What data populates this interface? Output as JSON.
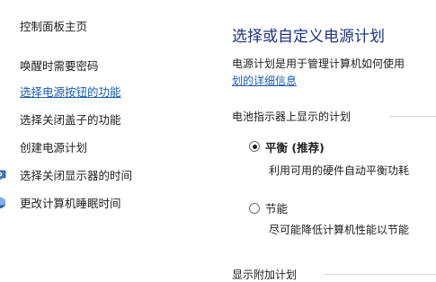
{
  "sidebar": {
    "home": "控制面板主页",
    "items": [
      "唤醒时需要密码",
      "选择电源按钮的功能",
      "选择关闭盖子的功能",
      "创建电源计划",
      "选择关闭显示器的时间",
      "更改计算机睡眠时间"
    ],
    "icons": [
      "monitor-clock-icon",
      "moon-sleep-icon"
    ]
  },
  "main": {
    "title": "选择或自定义电源计划",
    "description": "电源计划是用于管理计算机如何使用",
    "description_link": "划的详细信息",
    "battery_group_label": "电池指示器上显示的计划",
    "plans": [
      {
        "name": "平衡 (推荐)",
        "description": "利用可用的硬件自动平衡功耗",
        "selected": true
      },
      {
        "name": "节能",
        "description": "尽可能降低计算机性能以节能",
        "selected": false
      }
    ],
    "additional_group_label": "显示附加计划"
  },
  "colors": {
    "title": "#1e3287",
    "link": "#1a5fb4",
    "text": "#1e1e1e"
  }
}
